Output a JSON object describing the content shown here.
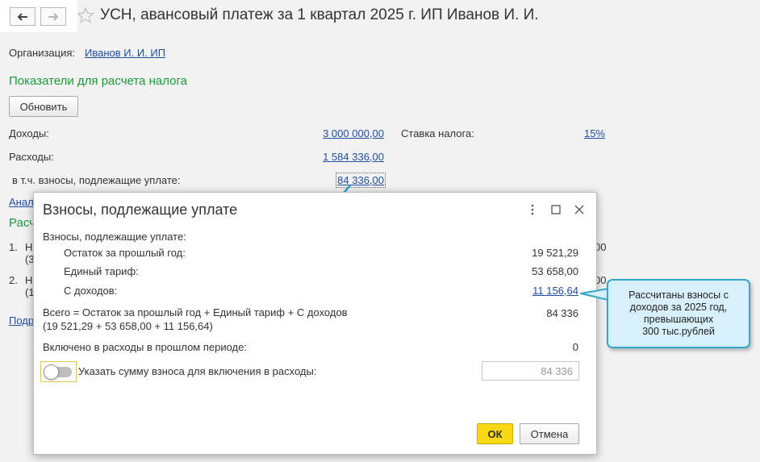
{
  "header": {
    "title": "УСН, авансовый платеж за 1 квартал 2025 г. ИП Иванов И. И."
  },
  "organization": {
    "label": "Организация:",
    "value": "Иванов И. И. ИП"
  },
  "section_indicators": "Показатели для расчета налога",
  "refresh_label": "Обновить",
  "indicators": {
    "income_label": "Доходы:",
    "income_value": "3 000 000,00",
    "expenses_label": "Расходы:",
    "expenses_value": "1 584 336,00",
    "contrib_label": "в т.ч. взносы, подлежащие уплате:",
    "contrib_value": "84 336,00",
    "rate_label": "Ставка налога:",
    "rate_value": "15%"
  },
  "background_partial": {
    "anal_link": "Анал",
    "section2": "Расч",
    "item1_num": "1.",
    "item1_text": "Н",
    "item1_sub": "(3",
    "item1_tail": "00",
    "item2_num": "2.",
    "item2_text": "Н",
    "item2_sub": "(1",
    "item2_tail": "00",
    "podr_link": "Подр"
  },
  "dialog": {
    "title": "Взносы, подлежащие уплате",
    "heading": "Взносы, подлежащие уплате:",
    "rows": [
      {
        "label": "Остаток за прошлый год:",
        "value": "19 521,29"
      },
      {
        "label": "Единый тариф:",
        "value": "53 658,00"
      },
      {
        "label": "С доходов:",
        "value": "11 156,64"
      }
    ],
    "total_label": "Всего = Остаток за прошлый год + Единый тариф + С доходов",
    "total_formula": "(19 521,29 + 53 658,00 + 11 156,64)",
    "total_value": "84 336",
    "included_label": "Включено в расходы в прошлом периоде:",
    "included_value": "0",
    "toggle_label": "Указать сумму взноса для включения в расходы:",
    "toggle_on": false,
    "amount_placeholder": "84 336",
    "ok_label": "ОК",
    "cancel_label": "Отмена"
  },
  "callout": {
    "text": "Рассчитаны взносы с\nдоходов за 2025 год,\nпревышающих\n300 тыс.рублей"
  },
  "colors": {
    "accent_link": "#1f4e9e",
    "section_green": "#1a9a3a",
    "ok_yellow": "#f8d812",
    "callout_border": "#33a9c9",
    "callout_fill": "#d8f0fb"
  },
  "icons": [
    "back-arrow-icon",
    "forward-arrow-icon",
    "star-icon",
    "more-icon",
    "maximize-icon",
    "close-icon"
  ]
}
